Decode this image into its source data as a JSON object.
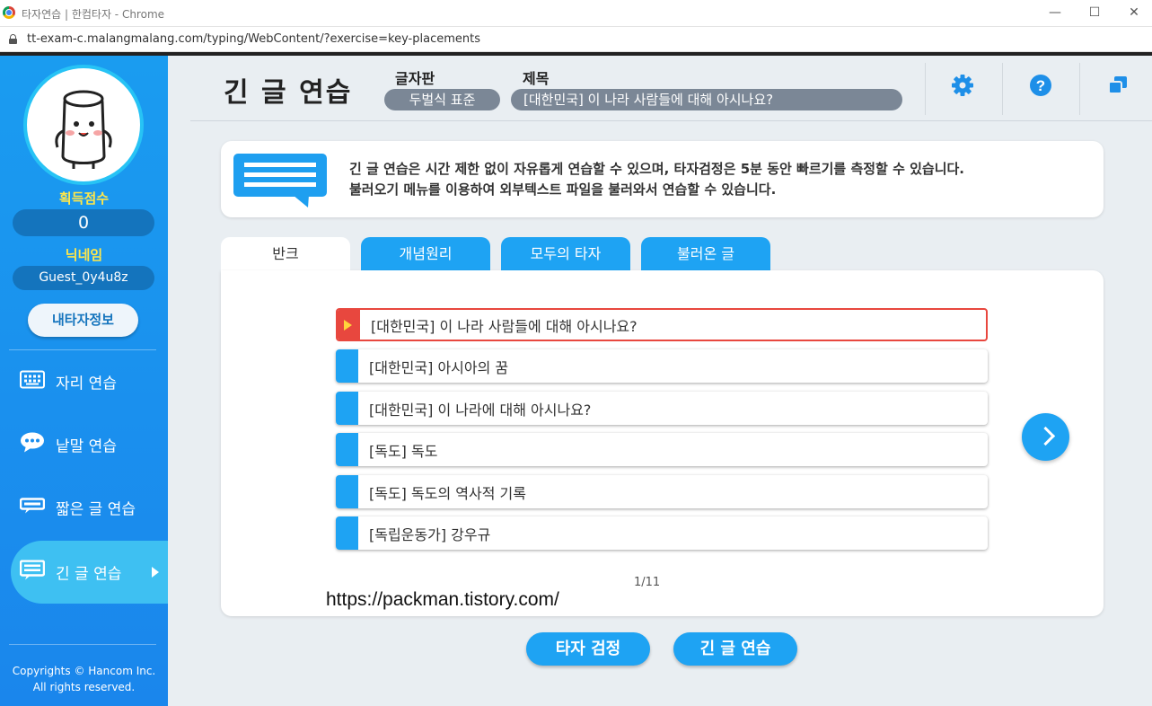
{
  "browser": {
    "window_title": "타자연습 | 한컴타자 - Chrome",
    "url": "tt-exam-c.malangmalang.com/typing/WebContent/?exercise=key-placements",
    "controls": {
      "minimize": "—",
      "maximize": "☐",
      "close": "✕"
    }
  },
  "sidebar": {
    "score_label": "획득점수",
    "score_value": "0",
    "nick_label": "닉네임",
    "nick_value": "Guest_0y4u8z",
    "myinfo_button": "내타자정보",
    "menu": [
      {
        "label": "자리 연습",
        "icon": "keyboard-icon"
      },
      {
        "label": "낱말 연습",
        "icon": "chat-icon"
      },
      {
        "label": "짧은 글 연습",
        "icon": "short-text-icon"
      },
      {
        "label": "긴 글 연습",
        "icon": "long-text-icon",
        "active": true
      }
    ],
    "copyright_line1": "Copyrights © Hancom Inc.",
    "copyright_line2": "All rights reserved."
  },
  "header": {
    "title": "긴 글 연습",
    "keyboard_label": "글자판",
    "keyboard_value": "두벌식 표준",
    "text_label": "제목",
    "text_value": "[대한민국] 이 나라 사람들에 대해 아시나요?",
    "buttons": [
      "gear-icon",
      "help-icon",
      "window-icon"
    ]
  },
  "info": {
    "line1": "긴 글 연습은 시간 제한 없이 자유롭게 연습할 수 있으며, 타자검정은 5분 동안 빠르기를 측정할 수 있습니다.",
    "line2": "불러오기 메뉴를 이용하여 외부텍스트 파일을 불러와서 연습할 수 있습니다."
  },
  "tabs": [
    "반크",
    "개념원리",
    "모두의 타자",
    "불러온 글"
  ],
  "list": [
    "[대한민국] 이 나라 사람들에 대해 아시나요?",
    "[대한민국] 아시아의 꿈",
    "[대한민국] 이 나라에 대해 아시나요?",
    "[독도] 독도",
    "[독도] 독도의 역사적 기록",
    "[독립운동가] 강우규"
  ],
  "pager": "1/11",
  "watermark": "https://packman.tistory.com/",
  "bottom_buttons": {
    "exam": "타자 검정",
    "practice": "긴 글 연습"
  },
  "colors": {
    "accent": "#1ea3f3",
    "selected": "#e8473e",
    "sidebar": "#1a9cf0"
  }
}
